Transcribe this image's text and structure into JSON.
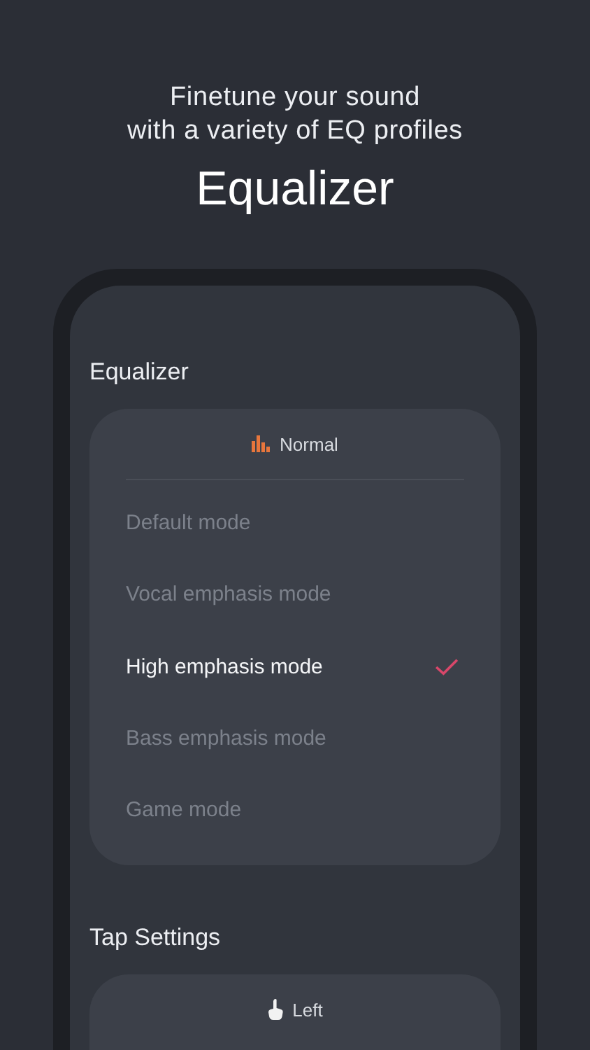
{
  "header": {
    "subtitle_lines": [
      "Finetune your sound",
      "with a variety of EQ profiles"
    ],
    "title": "Equalizer"
  },
  "equalizer": {
    "section_title": "Equalizer",
    "current": "Normal",
    "modes": [
      {
        "label": "Default mode",
        "selected": false
      },
      {
        "label": "Vocal emphasis mode",
        "selected": false
      },
      {
        "label": "High emphasis mode",
        "selected": true
      },
      {
        "label": "Bass emphasis mode",
        "selected": false
      },
      {
        "label": "Game mode",
        "selected": false
      }
    ]
  },
  "tap_settings": {
    "section_title": "Tap Settings",
    "current": "Left"
  }
}
